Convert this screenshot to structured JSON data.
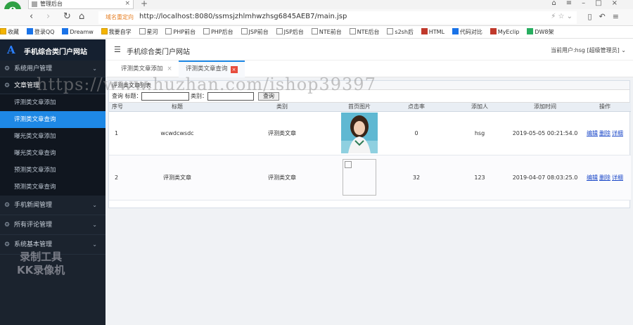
{
  "browser": {
    "tab_title": "管理后台",
    "url_warning": "域名重定向",
    "url": "http://localhost:8080/ssmsjzhlmhwzhsg6845AEB7/main.jsp",
    "bookmarks": [
      "收藏",
      "登录QQ",
      "Dreamw",
      "我要自学",
      "星河",
      "PHP前台",
      "PHP后台",
      "JSP前台",
      "JSP后台",
      "NTE前台",
      "NTE后台",
      "s2sh后",
      "HTML",
      "代码对比",
      "MyEclip",
      "DW8架"
    ]
  },
  "app": {
    "title": "手机综合类门户网站",
    "user_info": "当前用户:hsg [超级管理员]"
  },
  "sidebar": {
    "groups": [
      {
        "label": "系统用户管理",
        "open": false,
        "items": []
      },
      {
        "label": "文章管理",
        "open": true,
        "items": [
          {
            "label": "评测类文章添加",
            "active": false
          },
          {
            "label": "评测类文章查询",
            "active": true
          },
          {
            "label": "曝光类文章添加",
            "active": false
          },
          {
            "label": "曝光类文章查询",
            "active": false
          },
          {
            "label": "预测类文章添加",
            "active": false
          },
          {
            "label": "预测类文章查询",
            "active": false
          }
        ]
      },
      {
        "label": "手机新闻管理",
        "open": false,
        "items": []
      },
      {
        "label": "所有评论管理",
        "open": false,
        "items": []
      },
      {
        "label": "系统基本管理",
        "open": false,
        "items": []
      }
    ]
  },
  "page_tabs": [
    {
      "label": "评测类文章添加",
      "active": false
    },
    {
      "label": "评测类文章查询",
      "active": true
    }
  ],
  "panel": {
    "title": "评测类文章列表",
    "search_prefix": "查询 标题：",
    "category_label": "类别：",
    "search_button": "查询",
    "title_input_value": "",
    "category_input_value": ""
  },
  "table": {
    "headers": [
      "序号",
      "标题",
      "类别",
      "首页图片",
      "点击率",
      "添加人",
      "添加时间",
      "操作"
    ],
    "rows": [
      {
        "no": "1",
        "title": "wcwdcwsdc",
        "category": "评测类文章",
        "clicks": "0",
        "author": "hsg",
        "time": "2019-05-05 00:21:54.0"
      },
      {
        "no": "2",
        "title": "评测类文章",
        "category": "评测类文章",
        "clicks": "32",
        "author": "123",
        "time": "2019-04-07 08:03:25.0"
      }
    ],
    "ops": {
      "edit": "编辑",
      "delete": "删除",
      "detail": "详细"
    }
  },
  "overlay": {
    "watermark": "https://www.huzhan.com/ishop39397",
    "rec_line1": "录制工具",
    "rec_line2": "KK录像机"
  },
  "colors": {
    "sidebar_bg": "#1b232e",
    "active_item": "#1e88e5",
    "link": "#1a47c8"
  }
}
